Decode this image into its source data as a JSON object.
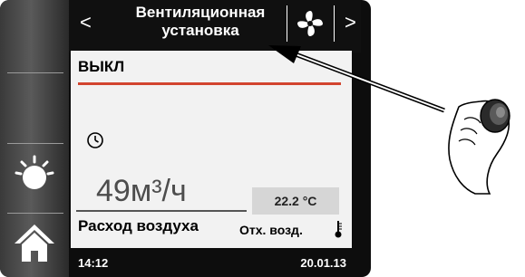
{
  "header": {
    "prev_label": "<",
    "next_label": ">",
    "title_line1": "Вентиляционная",
    "title_line2": "установка",
    "icon": "fan-icon"
  },
  "sidebar": {
    "items": [
      {
        "icon": "boost-icon"
      },
      {
        "icon": "home-icon"
      }
    ]
  },
  "main": {
    "status": "ВЫКЛ",
    "schedule_icon": "clock-icon",
    "airflow_value": "49м³/ч",
    "airflow_label": "Расход воздуха",
    "exhaust_temp": "22.2 °C",
    "exhaust_label": "Отх. возд.",
    "thermometer_icon": "thermometer-icon"
  },
  "footer": {
    "time": "14:12",
    "date": "20.01.13"
  },
  "colors": {
    "accent_red": "#d2442f",
    "screen_bg": "#f2f2f2",
    "frame": "#0d0d0d"
  }
}
